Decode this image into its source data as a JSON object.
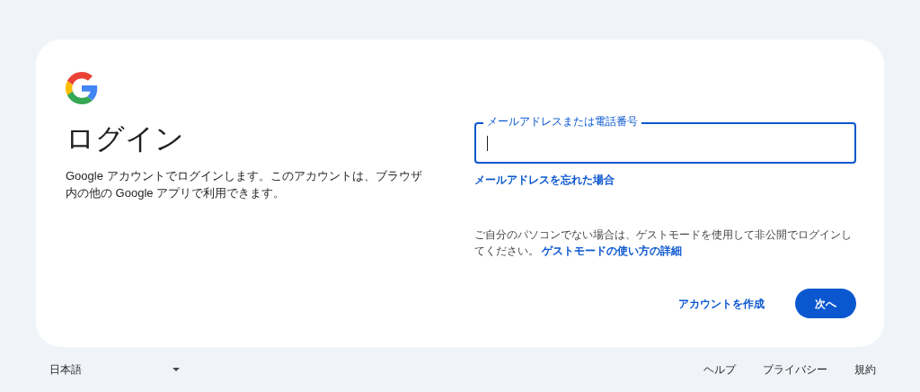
{
  "heading": "ログイン",
  "description": "Google アカウントでログインします。このアカウントは、ブラウザ内の他の Google アプリで利用できます。",
  "email_field": {
    "label": "メールアドレスまたは電話番号"
  },
  "forgot_email_link": "メールアドレスを忘れた場合",
  "guest_notice": {
    "text": "ご自分のパソコンでない場合は、ゲストモードを使用して非公開でログインしてください。",
    "link": "ゲストモードの使い方の詳細"
  },
  "buttons": [
    {
      "kind": "text",
      "label": "アカウントを作成"
    },
    {
      "kind": "filled",
      "label": "次へ"
    }
  ],
  "footer": {
    "language": "日本語",
    "links": [
      "ヘルプ",
      "プライバシー",
      "規約"
    ]
  }
}
